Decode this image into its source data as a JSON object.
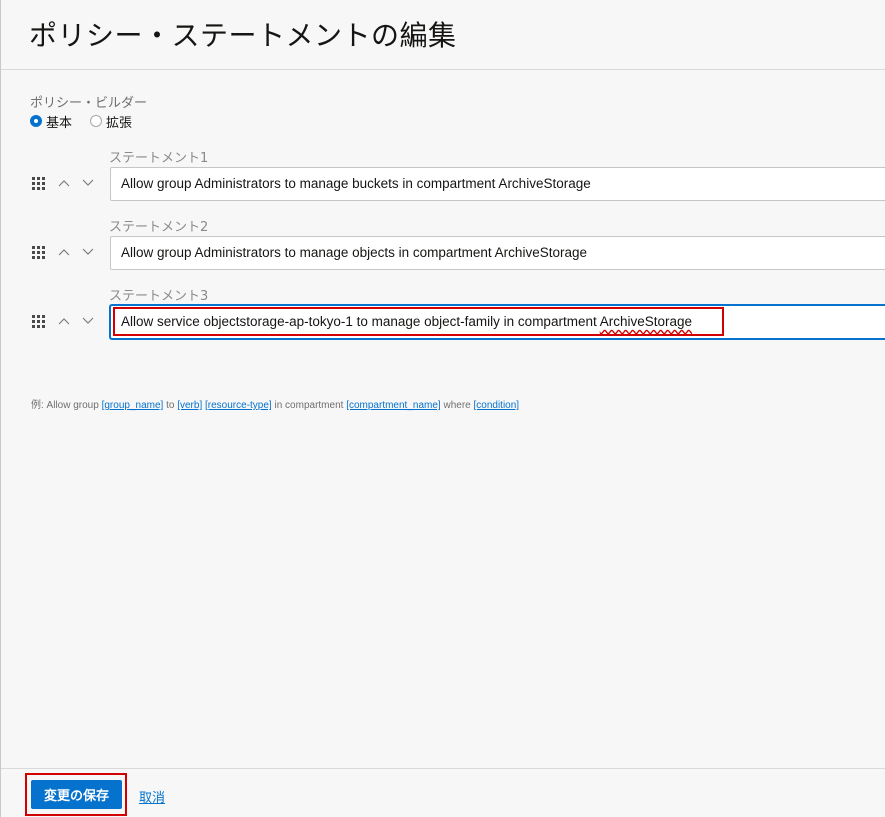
{
  "header": {
    "title": "ポリシー・ステートメントの編集"
  },
  "policy_builder": {
    "label": "ポリシー・ビルダー",
    "modes": [
      {
        "label": "基本",
        "selected": true
      },
      {
        "label": "拡張",
        "selected": false
      }
    ]
  },
  "statements": [
    {
      "label": "ステートメント1",
      "value": "Allow group Administrators to manage buckets in compartment ArchiveStorage"
    },
    {
      "label": "ステートメント2",
      "value": "Allow group Administrators to manage objects in compartment ArchiveStorage"
    },
    {
      "label": "ステートメント3",
      "value_prefix": "Allow service objectstorage-ap-tokyo-1 to manage object-family in compartment ",
      "value_flagged": "ArchiveStorage",
      "focused": true,
      "highlighted": true
    }
  ],
  "example": {
    "prefix": "例: Allow group ",
    "group_name": "[group_name]",
    "to": " to ",
    "verb": "[verb]",
    "space1": " ",
    "resource_type": "[resource-type]",
    "in_compartment": " in compartment ",
    "compartment_name": "[compartment_name]",
    "where": " where ",
    "condition": "[condition]"
  },
  "footer": {
    "save_label": "変更の保存",
    "cancel_label": "取消",
    "save_highlighted": true
  },
  "colors": {
    "primary": "#0572ce",
    "highlight_red": "#d20000",
    "background": "#f7f7f7"
  },
  "icons": [
    "drag-handle-icon",
    "chevron-up-icon",
    "chevron-down-icon"
  ]
}
